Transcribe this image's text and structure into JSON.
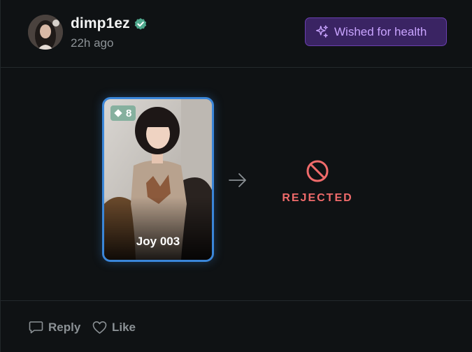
{
  "post": {
    "username": "dimp1ez",
    "timestamp": "22h ago",
    "wish_badge": {
      "label": "Wished for health",
      "icon": "sparkles-icon",
      "color": "#c9a4ff"
    },
    "verified_icon": "verified-check-icon",
    "accent": "#3a86d9"
  },
  "trade": {
    "card": {
      "name": "Joy 003",
      "level": "8",
      "level_icon": "diamond-icon"
    },
    "arrow_icon": "arrow-right-icon",
    "status": {
      "label": "REJECTED",
      "icon": "prohibited-icon",
      "color": "#f06b6b"
    }
  },
  "actions": {
    "reply_label": "Reply",
    "like_label": "Like"
  }
}
